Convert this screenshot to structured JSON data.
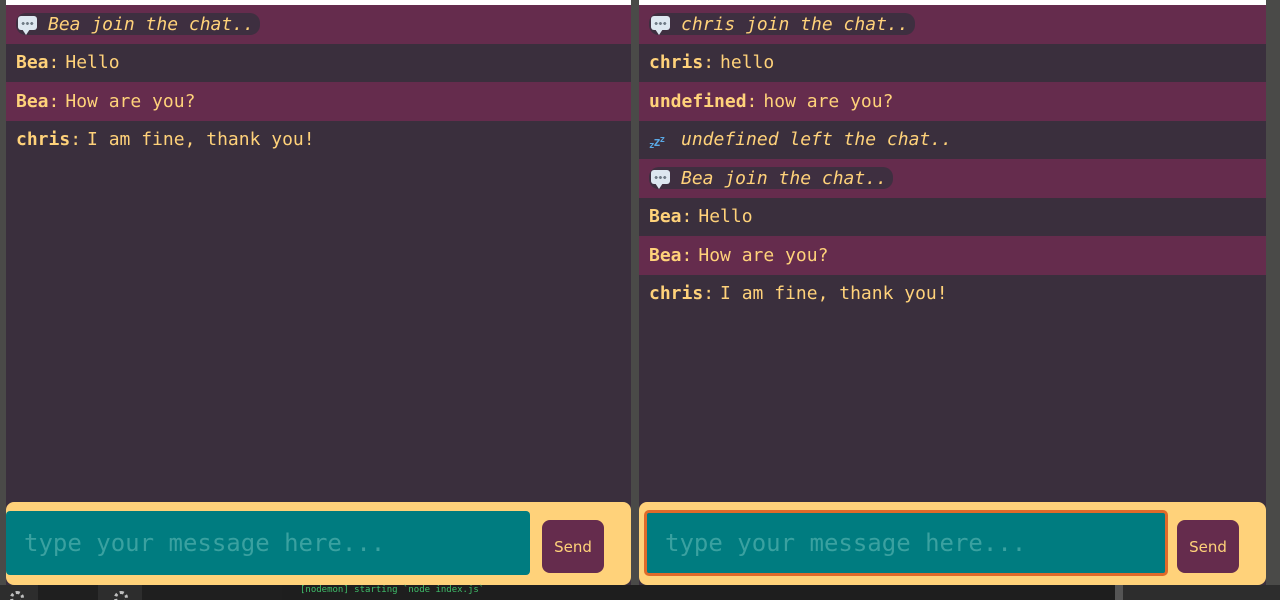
{
  "left_window": {
    "messages": [
      {
        "type": "system",
        "icon": "chat-bubble-icon",
        "text": "Bea join the chat.."
      },
      {
        "type": "chat",
        "user": "Bea",
        "sep": ":",
        "text": "Hello"
      },
      {
        "type": "chat",
        "user": "Bea",
        "sep": ":",
        "text": "How are you?"
      },
      {
        "type": "chat",
        "user": "chris",
        "sep": ":",
        "text": "I am fine, thank you!"
      }
    ],
    "input_placeholder": "type your message here...",
    "send_label": "Send"
  },
  "right_window": {
    "messages": [
      {
        "type": "system",
        "icon": "chat-bubble-icon",
        "text": "chris join the chat.."
      },
      {
        "type": "chat",
        "user": "chris",
        "sep": ":",
        "text": "hello"
      },
      {
        "type": "chat",
        "user": "undefined",
        "sep": ":",
        "text": "how are you?"
      },
      {
        "type": "system",
        "icon": "zzz-icon",
        "text": "undefined left the chat.."
      },
      {
        "type": "system",
        "icon": "chat-bubble-icon",
        "text": "Bea join the chat.."
      },
      {
        "type": "chat",
        "user": "Bea",
        "sep": ":",
        "text": "Hello"
      },
      {
        "type": "chat",
        "user": "Bea",
        "sep": ":",
        "text": "How are you?"
      },
      {
        "type": "chat",
        "user": "chris",
        "sep": ":",
        "text": "I am fine, thank you!"
      }
    ],
    "input_placeholder": "type your message here...",
    "send_label": "Send"
  },
  "terminal": {
    "line": "[nodemon] starting `node index.js`"
  },
  "colors": {
    "background": "#3a2f3d",
    "highlight_row": "#652c4d",
    "text": "#ffd27a",
    "composer": "#ffd27a",
    "input": "#007c80",
    "send_button": "#652c4d",
    "focus_ring": "#e06a2a"
  }
}
